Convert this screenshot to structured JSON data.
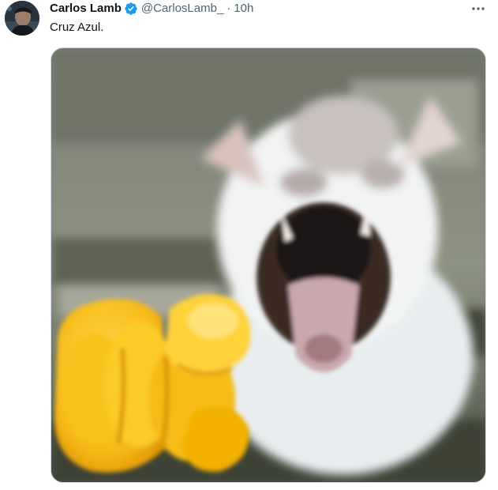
{
  "tweet": {
    "author": {
      "display_name": "Carlos Lamb",
      "handle": "@CarlosLamb_",
      "verified": true,
      "verified_icon": "verified-badge-icon",
      "verified_color": "#1d9bf0"
    },
    "separator": "·",
    "timestamp": "10h",
    "more_icon": "more-options-icon",
    "text": "Cruz Azul.",
    "media": {
      "type": "image",
      "subject": "meme-photo"
    }
  },
  "colors": {
    "text_primary": "#0f1419",
    "text_secondary": "#536471",
    "border": "#cfd9de"
  }
}
